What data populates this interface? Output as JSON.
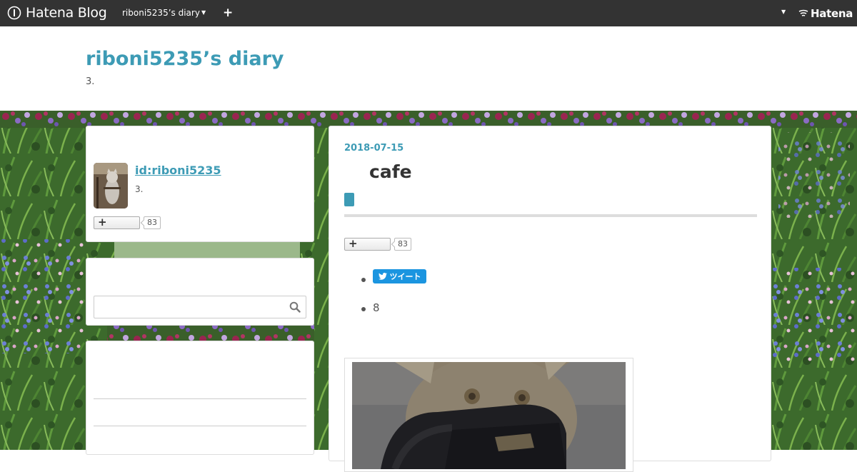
{
  "navbar": {
    "logo_text": "Hatena Blog",
    "blog_menu_label": "riboni5235’s diary",
    "add_label": "+",
    "hatena_label": "Hatena"
  },
  "header": {
    "blog_title": "riboni5235’s diary",
    "blog_description": "3."
  },
  "sidebar": {
    "profile": {
      "name": "id:riboni5235",
      "description": "3.",
      "subscriber_count": "83"
    },
    "search": {
      "placeholder": ""
    }
  },
  "entry": {
    "date": "2018-07-15",
    "title": "cafe",
    "subscriber_count": "83",
    "tweet_label": "ツイート",
    "share_count": "8"
  },
  "colors": {
    "navbar": "#333333",
    "accent": "#3d9bb5",
    "tweet": "#1b95e0"
  }
}
